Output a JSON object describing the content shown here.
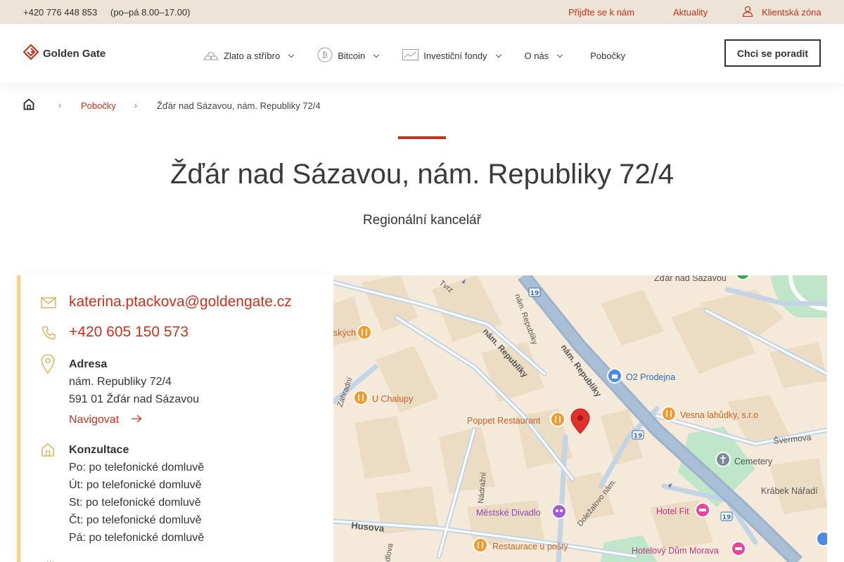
{
  "topbar": {
    "phone": "+420 776 448 853",
    "hours": "(po–pá 8.00–17.00)",
    "visit_link": "Přijďte se k nám",
    "news_link": "Aktuality",
    "client_zone": "Klientská zóna"
  },
  "header": {
    "logo_text": "Golden Gate",
    "nav": [
      {
        "label": "Zlato a stříbro",
        "icon": "gold-bars-icon",
        "has_dropdown": true
      },
      {
        "label": "Bitcoin",
        "icon": "bitcoin-icon",
        "has_dropdown": true
      },
      {
        "label": "Investiční fondy",
        "icon": "chart-icon",
        "has_dropdown": true
      },
      {
        "label": "O nás",
        "has_dropdown": true
      },
      {
        "label": "Pobočky",
        "has_dropdown": false
      }
    ],
    "cta_label": "Chci se poradit"
  },
  "breadcrumb": {
    "home_icon": "home-icon",
    "separator": "›",
    "parent": "Pobočky",
    "current": "Žďár nad Sázavou, nám. Republiky 72/4"
  },
  "page": {
    "title": "Žďár nad Sázavou, nám. Republiky 72/4",
    "subtitle": "Regionální kancelář"
  },
  "contact": {
    "email": "katerina.ptackova@goldengate.cz",
    "phone": "+420 605 150 573",
    "address_label": "Adresa",
    "address_line1": "nám. Republiky 72/4",
    "address_line2": "591 01 Žďár nad Sázavou",
    "navigate_label": "Navigovat",
    "consult_label": "Konzultace",
    "hours": [
      "Po: po telefonické domluvě",
      "Út: po telefonické domluvě",
      "St: po telefonické domluvě",
      "Čt: po telefonické domluvě",
      "Pá: po telefonické domluvě"
    ]
  },
  "map": {
    "labels": {
      "town": "Žďár nad Sázavou",
      "tvrz": "Tvrz",
      "street_republiky_small": "nám. Republiky",
      "street_republiky_1": "nám. Republiky",
      "street_republiky_2": "nám. Republiky",
      "route_1": "19",
      "route_2": "19",
      "route_3": "19",
      "o2": "O2 Prodejna",
      "vesna": "Vesna lahůdky, s.r.o",
      "svermova": "Švermova",
      "cemetery": "Cemetery",
      "krabek": "Krábek Nářadí",
      "hotel_fit": "Hotel Fit",
      "hotelovy": "Hotelový Dům Morava",
      "restaurace": "Restaurace u pošty",
      "divadlo": "Městské Divadlo",
      "dolezalovo": "Doležalovo nám.",
      "husova": "Husova",
      "nadrazni": "Nádražní",
      "poppet": "Poppet Restaurant",
      "u_chalupy": "U Chalupy",
      "zahradni": "Zahradní",
      "skych": "ských",
      "dlova": "dlova"
    },
    "colors": {
      "restaurant": "#f29a2e",
      "store": "#4a8ae8",
      "hotel": "#e8469a",
      "theater": "#a35bd6",
      "cemetery": "#7a8a96",
      "pin": "#e2302a",
      "green": "#bfe6c8"
    }
  },
  "colors": {
    "accent": "#c8321e",
    "topbar_bg": "#ede3d6",
    "panel_border": "#f4d48c",
    "icon_gold": "#d9a848"
  }
}
